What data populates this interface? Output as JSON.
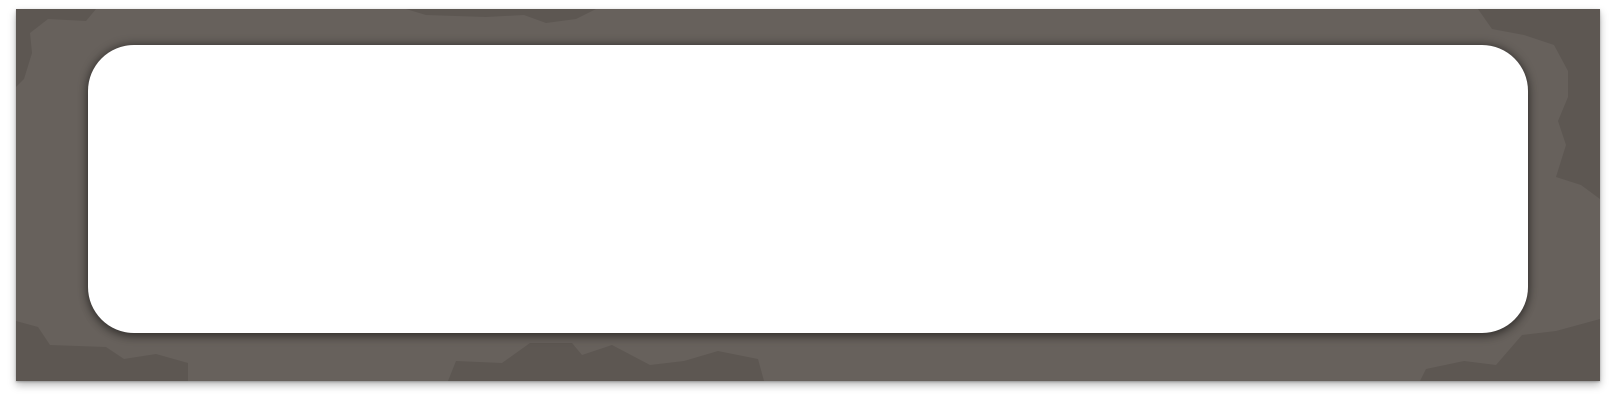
{
  "frame": {
    "name": "textured-frame",
    "colors": {
      "base": "#67615c",
      "dark_patch": "#5d5752",
      "panel": "#ffffff"
    }
  },
  "panel": {
    "content": ""
  }
}
